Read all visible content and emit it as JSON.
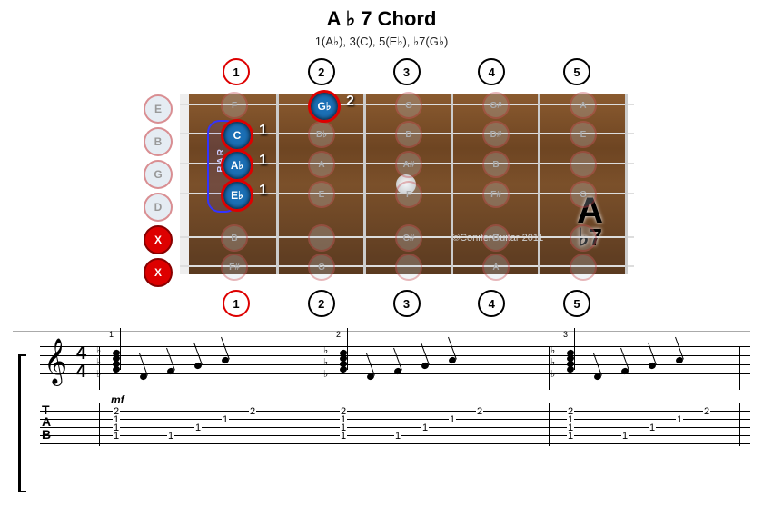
{
  "title": "A ♭ 7 Chord",
  "subtitle": "1(A♭), 3(C), 5(E♭), ♭7(G♭)",
  "fret_numbers": [
    "1",
    "2",
    "3",
    "4",
    "5"
  ],
  "open_strings": [
    {
      "label": "E",
      "muted": false
    },
    {
      "label": "B",
      "muted": false
    },
    {
      "label": "G",
      "muted": false
    },
    {
      "label": "D",
      "muted": false
    },
    {
      "label": "X",
      "muted": true
    },
    {
      "label": "X",
      "muted": true
    }
  ],
  "active_notes": [
    {
      "label": "G♭",
      "finger": "2",
      "string": 0,
      "fret": 1
    },
    {
      "label": "C",
      "finger": "1",
      "string": 1,
      "fret": 0
    },
    {
      "label": "A♭",
      "finger": "1",
      "string": 2,
      "fret": 0
    },
    {
      "label": "E♭",
      "finger": "1",
      "string": 3,
      "fret": 0
    }
  ],
  "ghost_notes": [
    {
      "l": "F",
      "s": 0,
      "f": 0
    },
    {
      "l": "G",
      "s": 0,
      "f": 2
    },
    {
      "l": "G#",
      "s": 0,
      "f": 3
    },
    {
      "l": "A",
      "s": 0,
      "f": 4
    },
    {
      "l": "D♭",
      "s": 1,
      "f": 1
    },
    {
      "l": "D",
      "s": 1,
      "f": 2
    },
    {
      "l": "D#",
      "s": 1,
      "f": 3
    },
    {
      "l": "E",
      "s": 1,
      "f": 4
    },
    {
      "l": "A",
      "s": 2,
      "f": 1
    },
    {
      "l": "A#",
      "s": 2,
      "f": 2
    },
    {
      "l": "B",
      "s": 2,
      "f": 3
    },
    {
      "l": "",
      "s": 2,
      "f": 4
    },
    {
      "l": "E",
      "s": 3,
      "f": 1
    },
    {
      "l": "F",
      "s": 3,
      "f": 2
    },
    {
      "l": "F#",
      "s": 3,
      "f": 3
    },
    {
      "l": "G",
      "s": 3,
      "f": 4
    },
    {
      "l": "B",
      "s": 4,
      "f": 0
    },
    {
      "l": "",
      "s": 4,
      "f": 1
    },
    {
      "l": "C#",
      "s": 4,
      "f": 2
    },
    {
      "l": "D",
      "s": 4,
      "f": 3
    },
    {
      "l": "",
      "s": 4,
      "f": 4
    },
    {
      "l": "F#",
      "s": 5,
      "f": 0
    },
    {
      "l": "G",
      "s": 5,
      "f": 1
    },
    {
      "l": "",
      "s": 5,
      "f": 2
    },
    {
      "l": "A",
      "s": 5,
      "f": 3
    },
    {
      "l": "",
      "s": 5,
      "f": 4
    }
  ],
  "big_chord": {
    "root": "A",
    "suffix": "♭7"
  },
  "copyright": "©ConiferGuitar  2011",
  "bar_label": "BAR",
  "notation": {
    "timesig_top": "4",
    "timesig_bot": "4",
    "dynamic": "mf",
    "voicings": [
      {
        "pos": 80,
        "fingering": "1",
        "tab": [
          "",
          "2",
          "1",
          "1",
          "1",
          ""
        ],
        "stack": 4
      },
      {
        "pos": 330,
        "fingering": "2",
        "tab": [
          "",
          "2",
          "1",
          "1",
          "1",
          ""
        ],
        "stack": 4
      },
      {
        "pos": 580,
        "fingering": "3",
        "tab": [
          "",
          "2",
          "1",
          "1",
          "1",
          ""
        ],
        "stack": 4
      }
    ],
    "arpeggio_offsets": [
      30,
      60,
      90,
      120,
      150,
      180
    ]
  }
}
